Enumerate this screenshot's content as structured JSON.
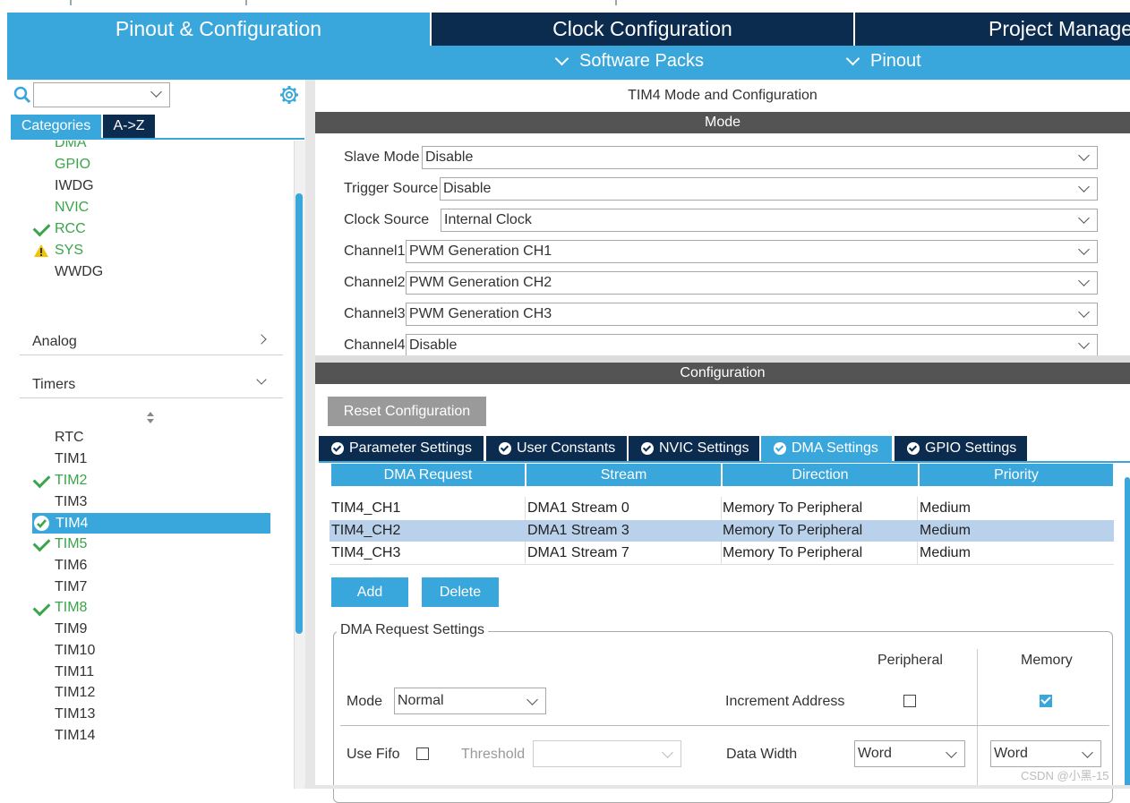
{
  "top_tabs": {
    "pinout": "Pinout & Configuration",
    "clock": "Clock Configuration",
    "project": "Project Manage"
  },
  "sub_menu": {
    "software_packs": "Software Packs",
    "pinout": "Pinout"
  },
  "left": {
    "search_value": "",
    "tabs": {
      "categories": "Categories",
      "az": "A->Z"
    },
    "system_items": [
      {
        "label": "DMA",
        "status": "green"
      },
      {
        "label": "GPIO",
        "status": "green"
      },
      {
        "label": "IWDG",
        "status": "none"
      },
      {
        "label": "NVIC",
        "status": "green"
      },
      {
        "label": "RCC",
        "status": "check"
      },
      {
        "label": "SYS",
        "status": "warning"
      },
      {
        "label": "WWDG",
        "status": "none"
      }
    ],
    "analog": "Analog",
    "timers": "Timers",
    "timer_items": [
      {
        "label": "RTC",
        "status": "none"
      },
      {
        "label": "TIM1",
        "status": "none"
      },
      {
        "label": "TIM2",
        "status": "check"
      },
      {
        "label": "TIM3",
        "status": "none"
      },
      {
        "label": "TIM4",
        "status": "selected"
      },
      {
        "label": "TIM5",
        "status": "check"
      },
      {
        "label": "TIM6",
        "status": "none"
      },
      {
        "label": "TIM7",
        "status": "none"
      },
      {
        "label": "TIM8",
        "status": "check"
      },
      {
        "label": "TIM9",
        "status": "none"
      },
      {
        "label": "TIM10",
        "status": "none"
      },
      {
        "label": "TIM11",
        "status": "none"
      },
      {
        "label": "TIM12",
        "status": "none"
      },
      {
        "label": "TIM13",
        "status": "none"
      },
      {
        "label": "TIM14",
        "status": "none"
      }
    ]
  },
  "main": {
    "title": "TIM4 Mode and Configuration",
    "mode_header": "Mode",
    "mode_rows": [
      {
        "label": "Slave Mode",
        "value": "Disable"
      },
      {
        "label": "Trigger Source",
        "value": "Disable"
      },
      {
        "label": "Clock Source",
        "value": "Internal Clock"
      },
      {
        "label": "Channel1",
        "value": "PWM Generation CH1"
      },
      {
        "label": "Channel2",
        "value": "PWM Generation CH2"
      },
      {
        "label": "Channel3",
        "value": "PWM Generation CH3"
      },
      {
        "label": "Channel4",
        "value": "Disable"
      }
    ],
    "config_header": "Configuration",
    "reset_button": "Reset Configuration",
    "config_tabs": [
      "Parameter Settings",
      "User Constants",
      "NVIC Settings",
      "DMA Settings",
      "GPIO Settings"
    ],
    "active_tab": "DMA Settings",
    "dma_table": {
      "headers": [
        "DMA Request",
        "Stream",
        "Direction",
        "Priority"
      ],
      "rows": [
        [
          "TIM4_CH1",
          "DMA1 Stream 0",
          "Memory To Peripheral",
          "Medium"
        ],
        [
          "TIM4_CH2",
          "DMA1 Stream 3",
          "Memory To Peripheral",
          "Medium"
        ],
        [
          "TIM4_CH3",
          "DMA1 Stream 7",
          "Memory To Peripheral",
          "Medium"
        ]
      ],
      "selected_row": 1
    },
    "add_button": "Add",
    "delete_button": "Delete",
    "request_settings": {
      "legend": "DMA Request Settings",
      "peripheral_header": "Peripheral",
      "memory_header": "Memory",
      "mode_label": "Mode",
      "mode_value": "Normal",
      "increment_label": "Increment Address",
      "peripheral_increment": false,
      "memory_increment": true,
      "use_fifo_label": "Use Fifo",
      "use_fifo": false,
      "threshold_label": "Threshold",
      "threshold_value": "",
      "data_width_label": "Data Width",
      "peripheral_width": "Word",
      "memory_width": "Word"
    }
  },
  "watermark": "CSDN @小黑-15",
  "colors": {
    "accent": "#3aa7dc",
    "navy": "#0b2b4f",
    "green": "#3aa54a",
    "header_gray": "#545454",
    "selected_row": "#b9d1ea"
  }
}
